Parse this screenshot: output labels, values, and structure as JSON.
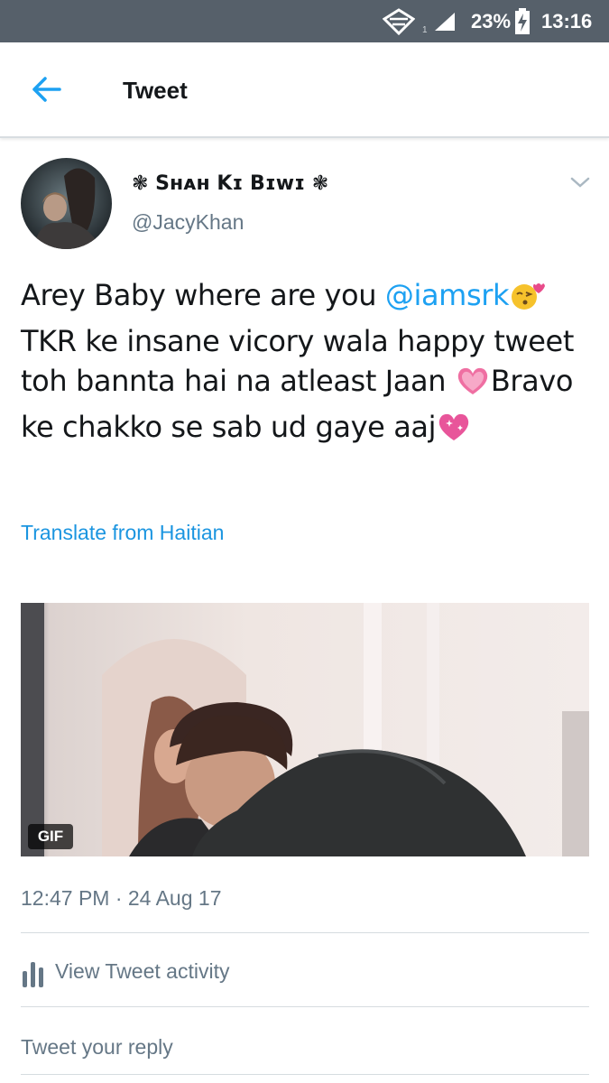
{
  "status_bar": {
    "battery_percent": "23%",
    "time": "13:16",
    "signal_small": "1",
    "icons": [
      "wifi-icon",
      "signal-icon",
      "battery-charging-icon"
    ]
  },
  "header": {
    "title": "Tweet",
    "back_icon": "arrow-left-icon"
  },
  "tweet": {
    "display_name": "❃ Sʜᴀʜ Kɪ Bɪᴡɪ ❃",
    "username": "@JacyKhan",
    "text_parts": {
      "p1": "Arey Baby where are you ",
      "mention": "@iamsrk",
      "p2": "TKR ke insane vicory wala happy tweet toh bannta hai na atleast Jaan ",
      "p3": "Bravo ke chakko se sab ud gaye aaj"
    },
    "emojis": [
      "face-blowing-kiss",
      "heart",
      "sparkling-heart"
    ],
    "translate_label": "Translate from Haitian",
    "media_badge": "GIF",
    "timestamp": "12:47 PM · 24 Aug 17",
    "activity_label": "View Tweet activity"
  },
  "reply": {
    "placeholder": "Tweet your reply"
  },
  "colors": {
    "accent": "#1da1f2",
    "status_bar": "#56606a",
    "secondary_text": "#657786"
  }
}
